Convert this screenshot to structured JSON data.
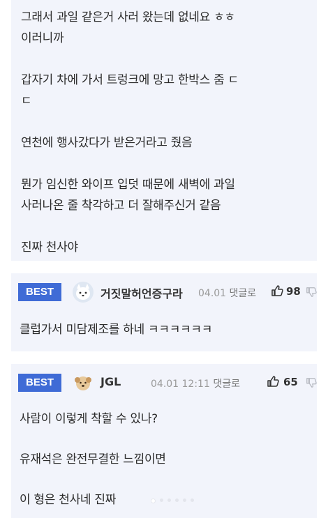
{
  "post": {
    "lines": [
      "그래서 과일 같은거 사러 왔는데 없네요 ㅎㅎ",
      "이러니까",
      "",
      "갑자기 차에 가서 트렁크에 망고 한박스 줌 ㄷ",
      "ㄷ",
      "",
      "연천에 행사갔다가 받은거라고 줬음",
      "",
      "뭔가 임신한 와이프 입덧 때문에 새벽에 과일",
      "사러나온 줄 착각하고 더 잘해주신거 같음",
      "",
      "진짜 천사야"
    ]
  },
  "comments": [
    {
      "badge": "BEST",
      "nickname": "거짓말허언증구라",
      "meta": "04.01",
      "reply": "댓글로",
      "likes": "98",
      "avatar_icon": "white-cartoon-dog-avatar",
      "lines": [
        "클럽가서 미담제조를 하네 ㅋㅋㅋㅋㅋㅋ"
      ]
    },
    {
      "badge": "BEST",
      "nickname": "JGL",
      "meta": "04.01 12:11",
      "reply": "댓글로",
      "likes": "65",
      "avatar_icon": "puppy-avatar",
      "lines": [
        "사람이 이렇게 착할 수 있나?",
        "유재석은 완전무결한 느낌이면",
        "이 형은 천사네 진짜"
      ]
    }
  ],
  "colors": {
    "card": "#f2f4fb",
    "best_badge": "#3f6bd6"
  }
}
